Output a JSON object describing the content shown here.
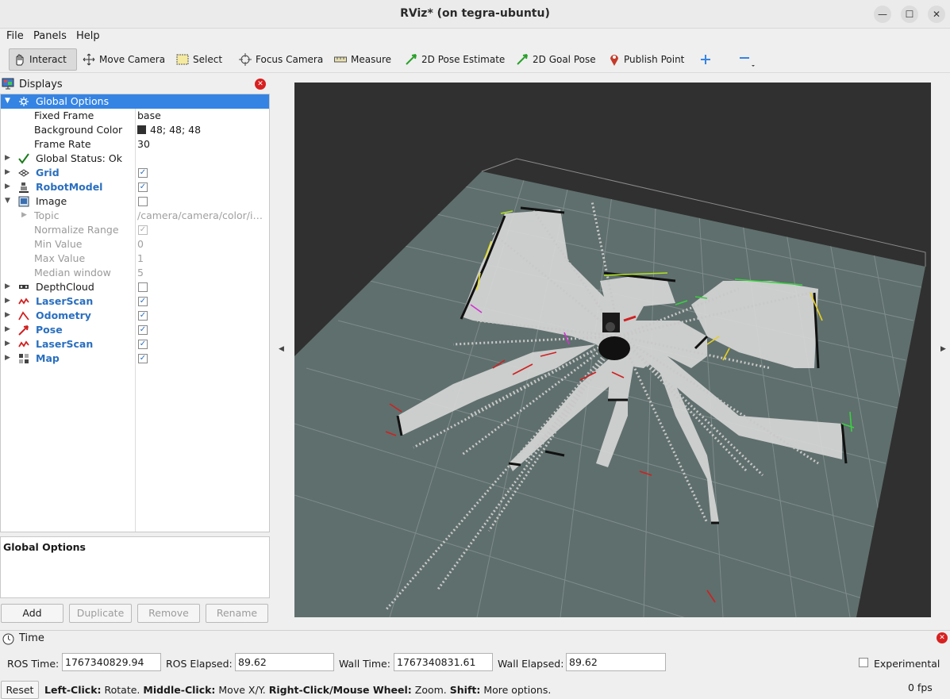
{
  "window": {
    "title": "RViz* (on tegra-ubuntu)"
  },
  "menu": {
    "file": "File",
    "panels": "Panels",
    "help": "Help"
  },
  "toolbar": {
    "interact": "Interact",
    "move_camera": "Move Camera",
    "select": "Select",
    "focus_camera": "Focus Camera",
    "measure": "Measure",
    "pose_estimate": "2D Pose Estimate",
    "goal_pose": "2D Goal Pose",
    "publish_point": "Publish Point"
  },
  "displays": {
    "title": "Displays",
    "global_options": "Global Options",
    "fixed_frame_label": "Fixed Frame",
    "fixed_frame_value": "base",
    "bg_color_label": "Background Color",
    "bg_color_value": "48; 48; 48",
    "bg_color_hex": "#303030",
    "frame_rate_label": "Frame Rate",
    "frame_rate_value": "30",
    "global_status": "Global Status: Ok",
    "grid": "Grid",
    "robot_model": "RobotModel",
    "image": "Image",
    "topic_label": "Topic",
    "topic_value": "/camera/camera/color/im...",
    "normalize_label": "Normalize Range",
    "min_label": "Min Value",
    "min_value": "0",
    "max_label": "Max Value",
    "max_value": "1",
    "median_label": "Median window",
    "median_value": "5",
    "depth_cloud": "DepthCloud",
    "laser_scan_1": "LaserScan",
    "odometry": "Odometry",
    "pose": "Pose",
    "laser_scan_2": "LaserScan",
    "map": "Map",
    "check_mark": "✓"
  },
  "description": {
    "title": "Global Options"
  },
  "panel_buttons": {
    "add": "Add",
    "duplicate": "Duplicate",
    "remove": "Remove",
    "rename": "Rename"
  },
  "time": {
    "title": "Time",
    "ros_time_label": "ROS Time:",
    "ros_time_value": "1767340829.94",
    "ros_elapsed_label": "ROS Elapsed:",
    "ros_elapsed_value": "89.62",
    "wall_time_label": "Wall Time:",
    "wall_time_value": "1767340831.61",
    "wall_elapsed_label": "Wall Elapsed:",
    "wall_elapsed_value": "89.62",
    "experimental_label": "Experimental",
    "reset": "Reset",
    "fps": "0 fps"
  },
  "status_bar": {
    "b1": "Left-Click:",
    "t1": " Rotate. ",
    "b2": "Middle-Click:",
    "t2": " Move X/Y. ",
    "b3": "Right-Click/Mouse Wheel:",
    "t3": " Zoom. ",
    "b4": "Shift:",
    "t4": " More options."
  }
}
